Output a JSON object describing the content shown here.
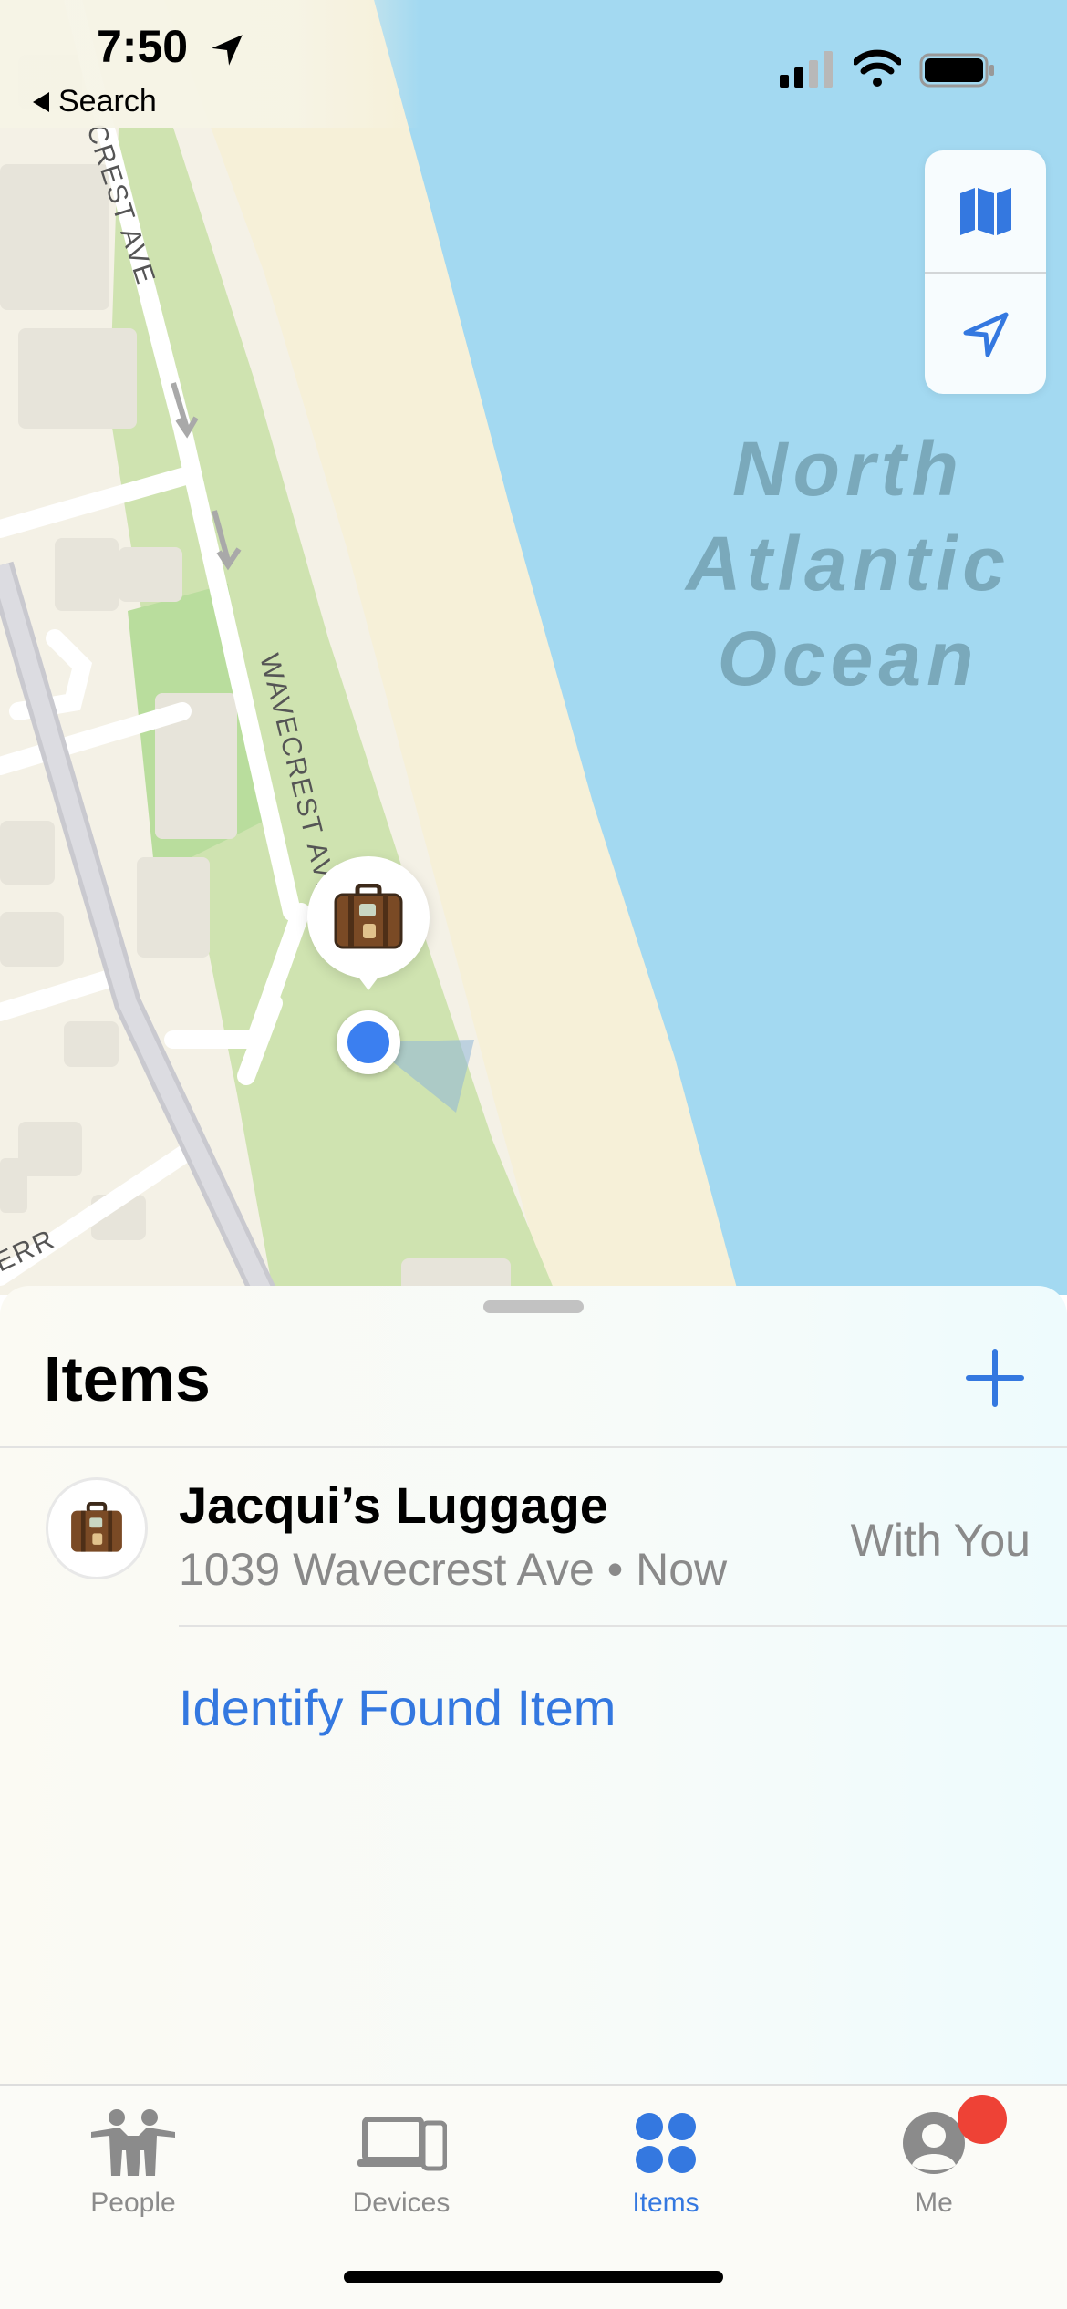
{
  "status_bar": {
    "time": "7:50",
    "back_label": "Search"
  },
  "map": {
    "ocean_label_lines": [
      "North",
      "Atlantic",
      "Ocean"
    ],
    "street_labels": [
      "CREST AVE",
      "WAVECREST AVE",
      "ERR"
    ],
    "controls": [
      {
        "icon": "map-icon"
      },
      {
        "icon": "location-arrow-icon"
      }
    ],
    "pin_icon": "luggage-icon"
  },
  "sheet": {
    "title": "Items",
    "add_icon": "plus-icon",
    "items": [
      {
        "name": "Jacqui’s Luggage",
        "subtitle": "1039 Wavecrest Ave • Now",
        "status": "With You",
        "icon": "luggage-icon"
      }
    ],
    "identify_label": "Identify Found Item"
  },
  "tab_bar": {
    "tabs": [
      {
        "label": "People",
        "icon": "people-icon",
        "active": false
      },
      {
        "label": "Devices",
        "icon": "devices-icon",
        "active": false
      },
      {
        "label": "Items",
        "icon": "items-icon",
        "active": true
      },
      {
        "label": "Me",
        "icon": "me-icon",
        "active": false
      }
    ]
  },
  "colors": {
    "accent": "#3478e0",
    "ocean": "#a3d9f1",
    "sand": "#f6f0d8",
    "park": "#cfe3b0",
    "badge": "#ee4236"
  }
}
